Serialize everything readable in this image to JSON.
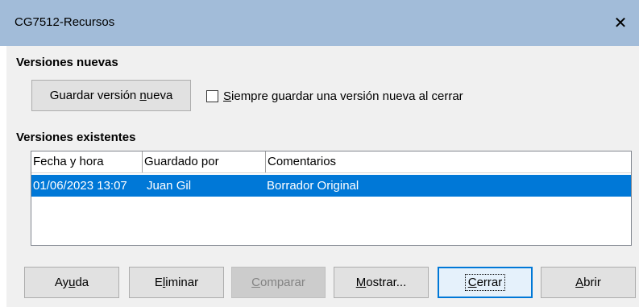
{
  "window": {
    "title": "CG7512-Recursos",
    "close_glyph": "✕"
  },
  "new_versions": {
    "heading": "Versiones nuevas",
    "save_button": {
      "pre": "Guardar versión ",
      "accel": "n",
      "post": "ueva"
    },
    "always_save_checkbox": {
      "checked": false,
      "accel": "S",
      "post": "iempre guardar una versión nueva al cerrar"
    }
  },
  "existing_versions": {
    "heading": "Versiones existentes",
    "columns": [
      "Fecha y hora",
      "Guardado por",
      "Comentarios"
    ],
    "rows": [
      {
        "date": "01/06/2023 13:07",
        "saved_by": "Juan Gil",
        "comment": "Borrador Original",
        "selected": true
      }
    ]
  },
  "buttons": {
    "help": {
      "pre": "Ay",
      "accel": "u",
      "post": "da"
    },
    "delete": {
      "pre": "E",
      "accel": "l",
      "post": "iminar"
    },
    "compare": {
      "pre": "",
      "accel": "C",
      "post": "omparar",
      "disabled": true
    },
    "show": {
      "pre": "",
      "accel": "M",
      "post": "ostrar..."
    },
    "close": {
      "pre": "",
      "accel": "C",
      "post": "errar"
    },
    "open": {
      "pre": "",
      "accel": "A",
      "post": "brir"
    }
  },
  "colors": {
    "titlebar": "#a2bcd9",
    "selection": "#0078d7",
    "dialog_bg": "#f0f0f0"
  }
}
